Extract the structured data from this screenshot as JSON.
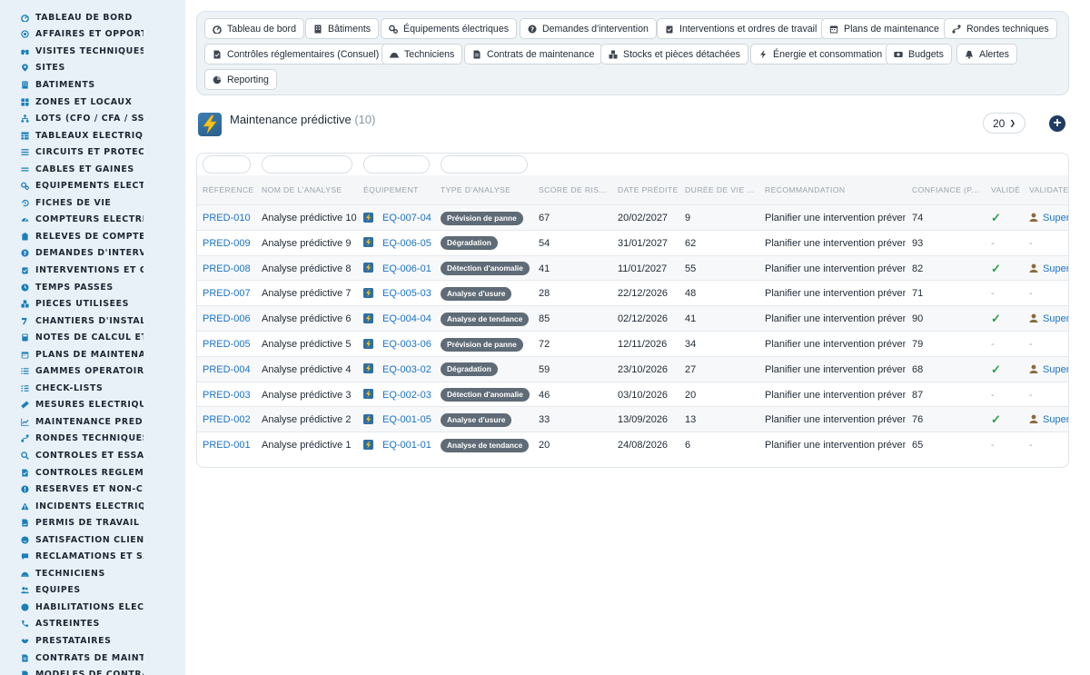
{
  "sidebar": {
    "items": [
      {
        "label": "TABLEAU DE BORD",
        "icon": "dashboard-icon"
      },
      {
        "label": "AFFAIRES ET OPPORTUNITÉS",
        "icon": "target-icon"
      },
      {
        "label": "VISITES TECHNIQUES ET AUDITS",
        "icon": "binoculars-icon"
      },
      {
        "label": "SITES",
        "icon": "map-pin-icon"
      },
      {
        "label": "BÂTIMENTS",
        "icon": "building-icon"
      },
      {
        "label": "ZONES ET LOCAUX",
        "icon": "grid-icon"
      },
      {
        "label": "LOTS (CFO / CFA / SSI...)",
        "icon": "sitemap-icon"
      },
      {
        "label": "TABLEAUX ÉLECTRIQUES",
        "icon": "table-icon"
      },
      {
        "label": "CIRCUITS ET PROTECTIONS",
        "icon": "list-icon"
      },
      {
        "label": "CÂBLES ET GAINES",
        "icon": "cable-icon"
      },
      {
        "label": "ÉQUIPEMENTS ÉLECTRIQUES",
        "icon": "cogs-icon"
      },
      {
        "label": "FICHES DE VIE",
        "icon": "history-icon"
      },
      {
        "label": "COMPTEURS ÉLECTRIQUES",
        "icon": "gauge-icon"
      },
      {
        "label": "RELEVÉS DE COMPTEURS",
        "icon": "clipboard-icon"
      },
      {
        "label": "DEMANDES D'INTERVENTION",
        "icon": "question-circle-icon"
      },
      {
        "label": "INTERVENTIONS ET ORDRES DE TRAVAIL",
        "icon": "clipboard-check-icon"
      },
      {
        "label": "TEMPS PASSÉS",
        "icon": "clock-icon"
      },
      {
        "label": "PIÈCES UTILISÉES",
        "icon": "boxes-icon"
      },
      {
        "label": "CHANTIERS D'INSTALLATION",
        "icon": "hammer-icon"
      },
      {
        "label": "NOTES DE CALCUL ET ÉTUDES",
        "icon": "calculator-icon"
      },
      {
        "label": "PLANS DE MAINTENANCE",
        "icon": "calendar-icon"
      },
      {
        "label": "GAMMES OPÉRATOIRES",
        "icon": "list-ol-icon"
      },
      {
        "label": "CHECK-LISTS",
        "icon": "checklist-icon"
      },
      {
        "label": "MESURES ÉLECTRIQUES",
        "icon": "ruler-icon"
      },
      {
        "label": "MAINTENANCE PRÉDICTIVE",
        "icon": "chart-line-icon"
      },
      {
        "label": "RONDES TECHNIQUES",
        "icon": "route-icon"
      },
      {
        "label": "CONTRÔLES ET ESSAIS",
        "icon": "search-icon"
      },
      {
        "label": "CONTRÔLES RÉGLEMENTAIRES",
        "icon": "file-check-icon"
      },
      {
        "label": "RÉSERVES ET NON-CONFORMITÉS",
        "icon": "exclamation-circle-icon"
      },
      {
        "label": "INCIDENTS ÉLECTRIQUES",
        "icon": "warning-icon"
      },
      {
        "label": "PERMIS DE TRAVAIL",
        "icon": "file-signature-icon"
      },
      {
        "label": "SATISFACTION CLIENT",
        "icon": "smile-icon"
      },
      {
        "label": "RÉCLAMATIONS ET SAV",
        "icon": "comment-icon"
      },
      {
        "label": "TECHNICIENS",
        "icon": "hard-hat-icon"
      },
      {
        "label": "ÉQUIPES",
        "icon": "users-icon"
      },
      {
        "label": "HABILITATIONS ÉLECTRIQUES",
        "icon": "certificate-icon"
      },
      {
        "label": "ASTREINTES",
        "icon": "phone-icon"
      },
      {
        "label": "PRESTATAIRES",
        "icon": "handshake-icon"
      },
      {
        "label": "CONTRATS DE MAINTENANCE",
        "icon": "file-contract-icon"
      },
      {
        "label": "MODÈLES DE CONTRATS",
        "icon": "file-icon"
      }
    ]
  },
  "nav": {
    "buttons": [
      {
        "label": "Tableau de bord",
        "icon": "dashboard-icon"
      },
      {
        "label": "Bâtiments",
        "icon": "building-icon"
      },
      {
        "label": "Équipements électriques",
        "icon": "cogs-icon"
      },
      {
        "label": "Demandes d'intervention",
        "icon": "question-circle-icon"
      },
      {
        "label": "Interventions et ordres de travail",
        "icon": "clipboard-check-icon"
      },
      {
        "label": "Plans de maintenance",
        "icon": "calendar-icon"
      },
      {
        "label": "Rondes techniques",
        "icon": "route-icon"
      },
      {
        "label": "Contrôles réglementaires (Consuel)",
        "icon": "file-check-icon"
      },
      {
        "label": "Techniciens",
        "icon": "hard-hat-icon"
      },
      {
        "label": "Contrats de maintenance",
        "icon": "file-contract-icon"
      },
      {
        "label": "Stocks et pièces détachées",
        "icon": "boxes-icon"
      },
      {
        "label": "Énergie et consommation",
        "icon": "bolt-icon"
      },
      {
        "label": "Budgets",
        "icon": "money-icon"
      },
      {
        "label": "Alertes",
        "icon": "bell-icon"
      },
      {
        "label": "Reporting",
        "icon": "chart-pie-icon"
      }
    ]
  },
  "page": {
    "title": "Maintenance prédictive",
    "count": "(10)",
    "icon": "lightning-icon",
    "per_page": "20",
    "add_icon": "plus-circle-icon"
  },
  "table": {
    "columns": [
      "RÉFÉRENCE",
      "NOM DE L'ANALYSE",
      "ÉQUIPEMENT",
      "TYPE D'ANALYSE",
      "SCORE DE RIS...",
      "DATE PRÉDITE",
      "DURÉE DE VIE ...",
      "RECOMMANDATION",
      "CONFIANCE (P...",
      "VALIDÉ",
      "VALIDATEUR"
    ],
    "rows": [
      {
        "ref": "PRED-010",
        "name": "Analyse prédictive 10",
        "equip": "EQ-007-04",
        "type": "Prévision de panne",
        "score": "67",
        "date": "20/02/2027",
        "life": "9",
        "reco": "Planifier une intervention préventive",
        "conf": "74",
        "valid": true,
        "validator": "Superadmin"
      },
      {
        "ref": "PRED-009",
        "name": "Analyse prédictive 9",
        "equip": "EQ-006-05",
        "type": "Dégradation",
        "score": "54",
        "date": "31/01/2027",
        "life": "62",
        "reco": "Planifier une intervention préventive",
        "conf": "93",
        "valid": false,
        "validator": "-"
      },
      {
        "ref": "PRED-008",
        "name": "Analyse prédictive 8",
        "equip": "EQ-006-01",
        "type": "Détection d'anomalie",
        "score": "41",
        "date": "11/01/2027",
        "life": "55",
        "reco": "Planifier une intervention préventive",
        "conf": "82",
        "valid": true,
        "validator": "Superadmin"
      },
      {
        "ref": "PRED-007",
        "name": "Analyse prédictive 7",
        "equip": "EQ-005-03",
        "type": "Analyse d'usure",
        "score": "28",
        "date": "22/12/2026",
        "life": "48",
        "reco": "Planifier une intervention préventive",
        "conf": "71",
        "valid": false,
        "validator": "-"
      },
      {
        "ref": "PRED-006",
        "name": "Analyse prédictive 6",
        "equip": "EQ-004-04",
        "type": "Analyse de tendance",
        "score": "85",
        "date": "02/12/2026",
        "life": "41",
        "reco": "Planifier une intervention préventive",
        "conf": "90",
        "valid": true,
        "validator": "Superadmin"
      },
      {
        "ref": "PRED-005",
        "name": "Analyse prédictive 5",
        "equip": "EQ-003-06",
        "type": "Prévision de panne",
        "score": "72",
        "date": "12/11/2026",
        "life": "34",
        "reco": "Planifier une intervention préventive",
        "conf": "79",
        "valid": false,
        "validator": "-"
      },
      {
        "ref": "PRED-004",
        "name": "Analyse prédictive 4",
        "equip": "EQ-003-02",
        "type": "Dégradation",
        "score": "59",
        "date": "23/10/2026",
        "life": "27",
        "reco": "Planifier une intervention préventive",
        "conf": "68",
        "valid": true,
        "validator": "Superadmin"
      },
      {
        "ref": "PRED-003",
        "name": "Analyse prédictive 3",
        "equip": "EQ-002-03",
        "type": "Détection d'anomalie",
        "score": "46",
        "date": "03/10/2026",
        "life": "20",
        "reco": "Planifier une intervention préventive",
        "conf": "87",
        "valid": false,
        "validator": "-"
      },
      {
        "ref": "PRED-002",
        "name": "Analyse prédictive 2",
        "equip": "EQ-001-05",
        "type": "Analyse d'usure",
        "score": "33",
        "date": "13/09/2026",
        "life": "13",
        "reco": "Planifier une intervention préventive",
        "conf": "76",
        "valid": true,
        "validator": "Superadmin"
      },
      {
        "ref": "PRED-001",
        "name": "Analyse prédictive 1",
        "equip": "EQ-001-01",
        "type": "Analyse de tendance",
        "score": "20",
        "date": "24/08/2026",
        "life": "6",
        "reco": "Planifier une intervention préventive",
        "conf": "65",
        "valid": false,
        "validator": "-"
      }
    ],
    "dash": "-",
    "check_icon": "check-icon",
    "user_icon": "user-icon",
    "equip_icon": "equipment-icon"
  },
  "colors": {
    "accent": "#1a73c8",
    "sidebar_bg": "#e8f1f8",
    "badge_bg": "#5f6b76",
    "check": "#2aa04a",
    "add_button": "#1f3b66"
  }
}
